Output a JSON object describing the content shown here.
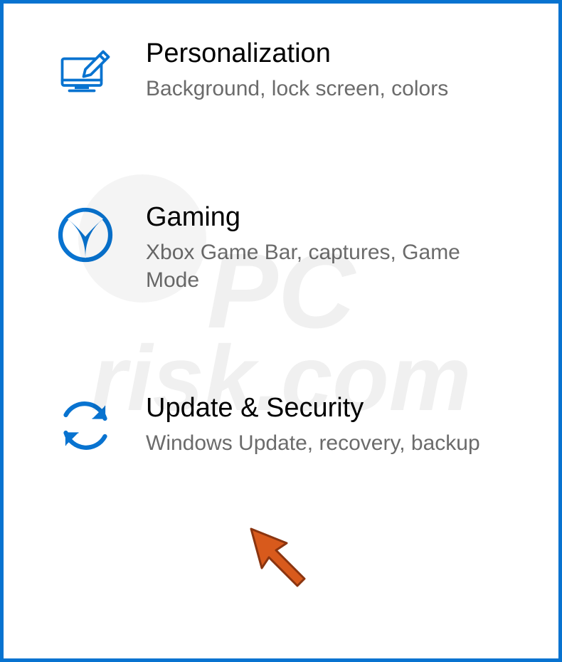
{
  "settings": {
    "items": [
      {
        "title": "Personalization",
        "desc": "Background, lock screen, colors"
      },
      {
        "title": "Gaming",
        "desc": "Xbox Game Bar, captures, Game Mode"
      },
      {
        "title": "Update & Security",
        "desc": "Windows Update, recovery, backup"
      }
    ]
  },
  "watermark": {
    "line1": "PC",
    "line2": "risk.com"
  },
  "colors": {
    "accent": "#0873d0",
    "border": "#0873d0",
    "cursor": "#d85a1c"
  }
}
